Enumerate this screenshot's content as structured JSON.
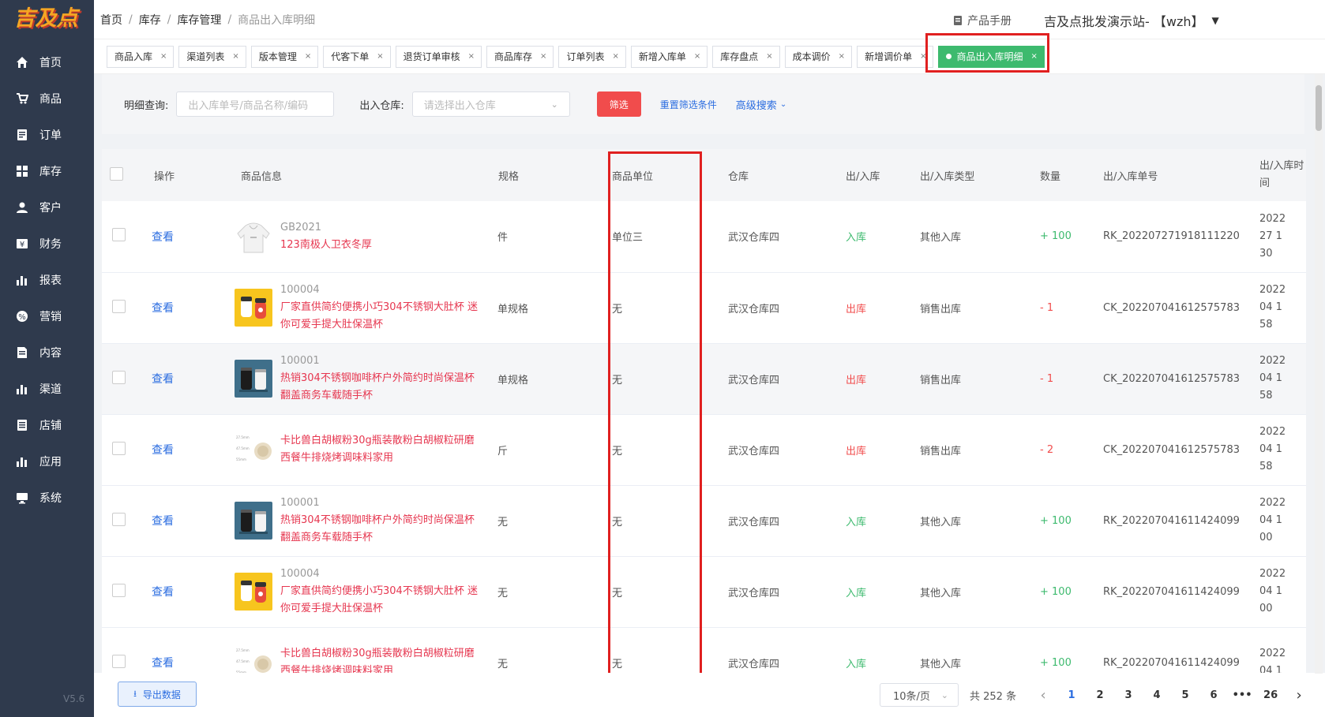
{
  "logo": "吉及点",
  "version": "V5.6",
  "sidebar": {
    "items": [
      {
        "label": "首页",
        "icon": "home-icon"
      },
      {
        "label": "商品",
        "icon": "cart-icon"
      },
      {
        "label": "订单",
        "icon": "order-icon"
      },
      {
        "label": "库存",
        "icon": "grid-icon"
      },
      {
        "label": "客户",
        "icon": "user-icon"
      },
      {
        "label": "财务",
        "icon": "finance-icon"
      },
      {
        "label": "报表",
        "icon": "bar-chart-icon"
      },
      {
        "label": "营销",
        "icon": "percent-icon"
      },
      {
        "label": "内容",
        "icon": "document-icon"
      },
      {
        "label": "渠道",
        "icon": "bar-chart-icon"
      },
      {
        "label": "店铺",
        "icon": "store-icon"
      },
      {
        "label": "应用",
        "icon": "bar-chart-icon"
      },
      {
        "label": "系统",
        "icon": "monitor-icon"
      }
    ]
  },
  "header": {
    "breadcrumb": [
      "首页",
      "库存",
      "库存管理",
      "商品出入库明细"
    ],
    "manual": "产品手册",
    "site": "吉及点批发演示站- 【wzh】"
  },
  "tabs": [
    {
      "label": "商品入库"
    },
    {
      "label": "渠道列表"
    },
    {
      "label": "版本管理"
    },
    {
      "label": "代客下单"
    },
    {
      "label": "退货订单审核"
    },
    {
      "label": "商品库存"
    },
    {
      "label": "订单列表"
    },
    {
      "label": "新增入库单"
    },
    {
      "label": "库存盘点"
    },
    {
      "label": "成本调价"
    },
    {
      "label": "新增调价单"
    },
    {
      "label": "商品出入库明细",
      "active": true
    }
  ],
  "filter": {
    "query_label": "明细查询:",
    "query_placeholder": "出入库单号/商品名称/编码",
    "warehouse_label": "出入仓库:",
    "warehouse_placeholder": "请选择出入仓库",
    "filter_button": "筛选",
    "reset": "重置筛选条件",
    "advanced": "高级搜索"
  },
  "table": {
    "headers": [
      "操作",
      "商品信息",
      "规格",
      "商品单位",
      "仓库",
      "出/入库",
      "出/入库类型",
      "数量",
      "出/入库单号",
      "出/入库时",
      "间"
    ],
    "view_label": "查看",
    "rows": [
      {
        "code": "GB2021",
        "name1": "123南极人卫衣冬厚",
        "name2": "",
        "spec": "件",
        "unit": "单位三",
        "warehouse": "武汉仓库四",
        "dir": "入库",
        "type": "其他入库",
        "qty": "+ 100",
        "no": "RK_202207271918111220",
        "t1": "2022",
        "t2": "27 1",
        "t3": "30",
        "thumb": "hoodie"
      },
      {
        "code": "100004",
        "name1": "厂家直供简约便携小巧304不锈钢大肚杯 迷",
        "name2": "你可爱手提大肚保温杯",
        "spec": "单规格",
        "unit": "无",
        "warehouse": "武汉仓库四",
        "dir": "出库",
        "type": "销售出库",
        "qty": "- 1",
        "no": "CK_202207041612575783",
        "t1": "2022",
        "t2": "04 1",
        "t3": "58",
        "thumb": "cup"
      },
      {
        "code": "100001",
        "name1": "热销304不锈钢咖啡杯户外简约时尚保温杯",
        "name2": "翻盖商务车载随手杯",
        "spec": "单规格",
        "unit": "无",
        "warehouse": "武汉仓库四",
        "dir": "出库",
        "type": "销售出库",
        "qty": "- 1",
        "no": "CK_202207041612575783",
        "t1": "2022",
        "t2": "04 1",
        "t3": "58",
        "thumb": "mug"
      },
      {
        "code": "",
        "name1": "卡比兽白胡椒粉30g瓶装散粉白胡椒粒研磨",
        "name2": "西餐牛排烧烤调味料家用",
        "spec": "斤",
        "unit": "无",
        "warehouse": "武汉仓库四",
        "dir": "出库",
        "type": "销售出库",
        "qty": "- 2",
        "no": "CK_202207041612575783",
        "t1": "2022",
        "t2": "04 1",
        "t3": "58",
        "thumb": "pepper"
      },
      {
        "code": "100001",
        "name1": "热销304不锈钢咖啡杯户外简约时尚保温杯",
        "name2": "翻盖商务车载随手杯",
        "spec": "无",
        "unit": "无",
        "warehouse": "武汉仓库四",
        "dir": "入库",
        "type": "其他入库",
        "qty": "+ 100",
        "no": "RK_202207041611424099",
        "t1": "2022",
        "t2": "04 1",
        "t3": "00",
        "thumb": "mug"
      },
      {
        "code": "100004",
        "name1": "厂家直供简约便携小巧304不锈钢大肚杯 迷",
        "name2": "你可爱手提大肚保温杯",
        "spec": "无",
        "unit": "无",
        "warehouse": "武汉仓库四",
        "dir": "入库",
        "type": "其他入库",
        "qty": "+ 100",
        "no": "RK_202207041611424099",
        "t1": "2022",
        "t2": "04 1",
        "t3": "00",
        "thumb": "cup"
      },
      {
        "code": "",
        "name1": "卡比兽白胡椒粉30g瓶装散粉白胡椒粒研磨",
        "name2": "西餐牛排烧烤调味料家用",
        "spec": "无",
        "unit": "无",
        "warehouse": "武汉仓库四",
        "dir": "入库",
        "type": "其他入库",
        "qty": "+ 100",
        "no": "RK_202207041611424099",
        "t1": "2022",
        "t2": "04 1",
        "t3": "",
        "thumb": "pepper"
      }
    ]
  },
  "footer": {
    "export": "导出数据",
    "page_size": "10条/页",
    "total": "共 252 条",
    "pages": [
      "1",
      "2",
      "3",
      "4",
      "5",
      "6",
      "•••",
      "26"
    ],
    "prev": "‹",
    "next": "›"
  },
  "colors": {
    "sidebar": "#2f3a4d",
    "accent_red": "#f14c4c",
    "accent_green": "#3dba6e",
    "link": "#2b6de0",
    "highlight": "#e02020"
  }
}
